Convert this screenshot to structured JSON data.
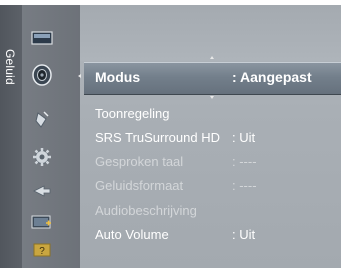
{
  "tab": {
    "label": "Geluid"
  },
  "sidebar": {
    "icons": [
      {
        "name": "picture-icon"
      },
      {
        "name": "sound-icon"
      },
      {
        "name": "channel-icon"
      },
      {
        "name": "setup-icon"
      },
      {
        "name": "input-icon"
      },
      {
        "name": "application-icon"
      },
      {
        "name": "support-icon"
      }
    ]
  },
  "menu": {
    "selected": {
      "label": "Modus",
      "value": ": Aangepast"
    },
    "items": [
      {
        "label": "Toonregeling",
        "value": "",
        "enabled": true
      },
      {
        "label": "SRS TruSurround HD",
        "value": ": Uit",
        "enabled": true
      },
      {
        "label": "Gesproken taal",
        "value": ": ----",
        "enabled": false
      },
      {
        "label": "Geluidsformaat",
        "value": ": ----",
        "enabled": false
      },
      {
        "label": "Audiobeschrijving",
        "value": "",
        "enabled": false
      },
      {
        "label": "Auto Volume",
        "value": ": Uit",
        "enabled": true
      }
    ]
  },
  "colors": {
    "panel": "#aab0b6",
    "sidebar": "#72777e",
    "tab": "#565b62",
    "selected_bar": "#737f8b",
    "text_active": "#ffffff",
    "text_disabled": "#d3d6d9"
  }
}
